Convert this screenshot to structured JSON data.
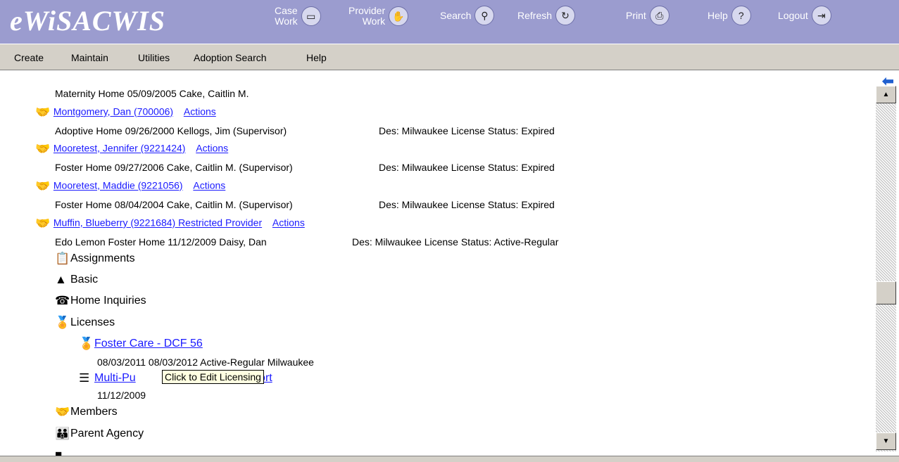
{
  "app": {
    "logo": "eWiSACWIS"
  },
  "toolbar": {
    "case_work": [
      "Case",
      "Work"
    ],
    "provider_work": [
      "Provider",
      "Work"
    ],
    "search": "Search",
    "refresh": "Refresh",
    "print": "Print",
    "help": "Help",
    "logout": "Logout"
  },
  "menu": [
    "Create",
    "Maintain",
    "Utilities",
    "Adoption Search",
    "Help"
  ],
  "tree": {
    "row0": "Maternity Home  05/09/2005  Cake, Caitlin M.",
    "p1_link": "Montgomery, Dan (700006)",
    "p1_actions": "Actions",
    "p1_detail": "Adoptive Home  09/26/2000  Kellogs, Jim (Supervisor)",
    "p1_status": "Des: Milwaukee  License Status: Expired",
    "p2_link": "Mooretest, Jennifer (9221424)",
    "p2_actions": "Actions",
    "p2_detail": "Foster Home  09/27/2006  Cake, Caitlin M. (Supervisor)",
    "p2_status": "Des: Milwaukee  License Status: Expired",
    "p3_link": "Mooretest, Maddie (9221056)",
    "p3_actions": "Actions",
    "p3_detail": "Foster Home  08/04/2004  Cake, Caitlin M. (Supervisor)",
    "p3_status": "Des: Milwaukee  License Status: Expired",
    "p4_link": "Muffin, Blueberry (9221684)   Restricted Provider",
    "p4_actions": "Actions",
    "p4_detail": "Edo Lemon  Foster Home  11/12/2009  Daisy, Dan",
    "p4_status": "Des: Milwaukee  License Status: Active-Regular",
    "assignments": "Assignments",
    "basic": "Basic",
    "home_inquiries": "Home Inquiries",
    "licenses": "Licenses",
    "license_link": "Foster Care - DCF 56",
    "license_detail": "08/03/2011    08/03/2012    Active-Regular      Milwaukee",
    "report_link_a": "Multi-Pu",
    "report_link_b": "Report",
    "report_date": "11/12/2009",
    "members": "Members",
    "parent_agency": "Parent Agency"
  },
  "tooltip": "Click to Edit Licensing",
  "colors": {
    "header": "#9b9ccf",
    "link": "#1a1aff",
    "license_link": "#ee1111",
    "menubar": "#d4d0c8"
  }
}
